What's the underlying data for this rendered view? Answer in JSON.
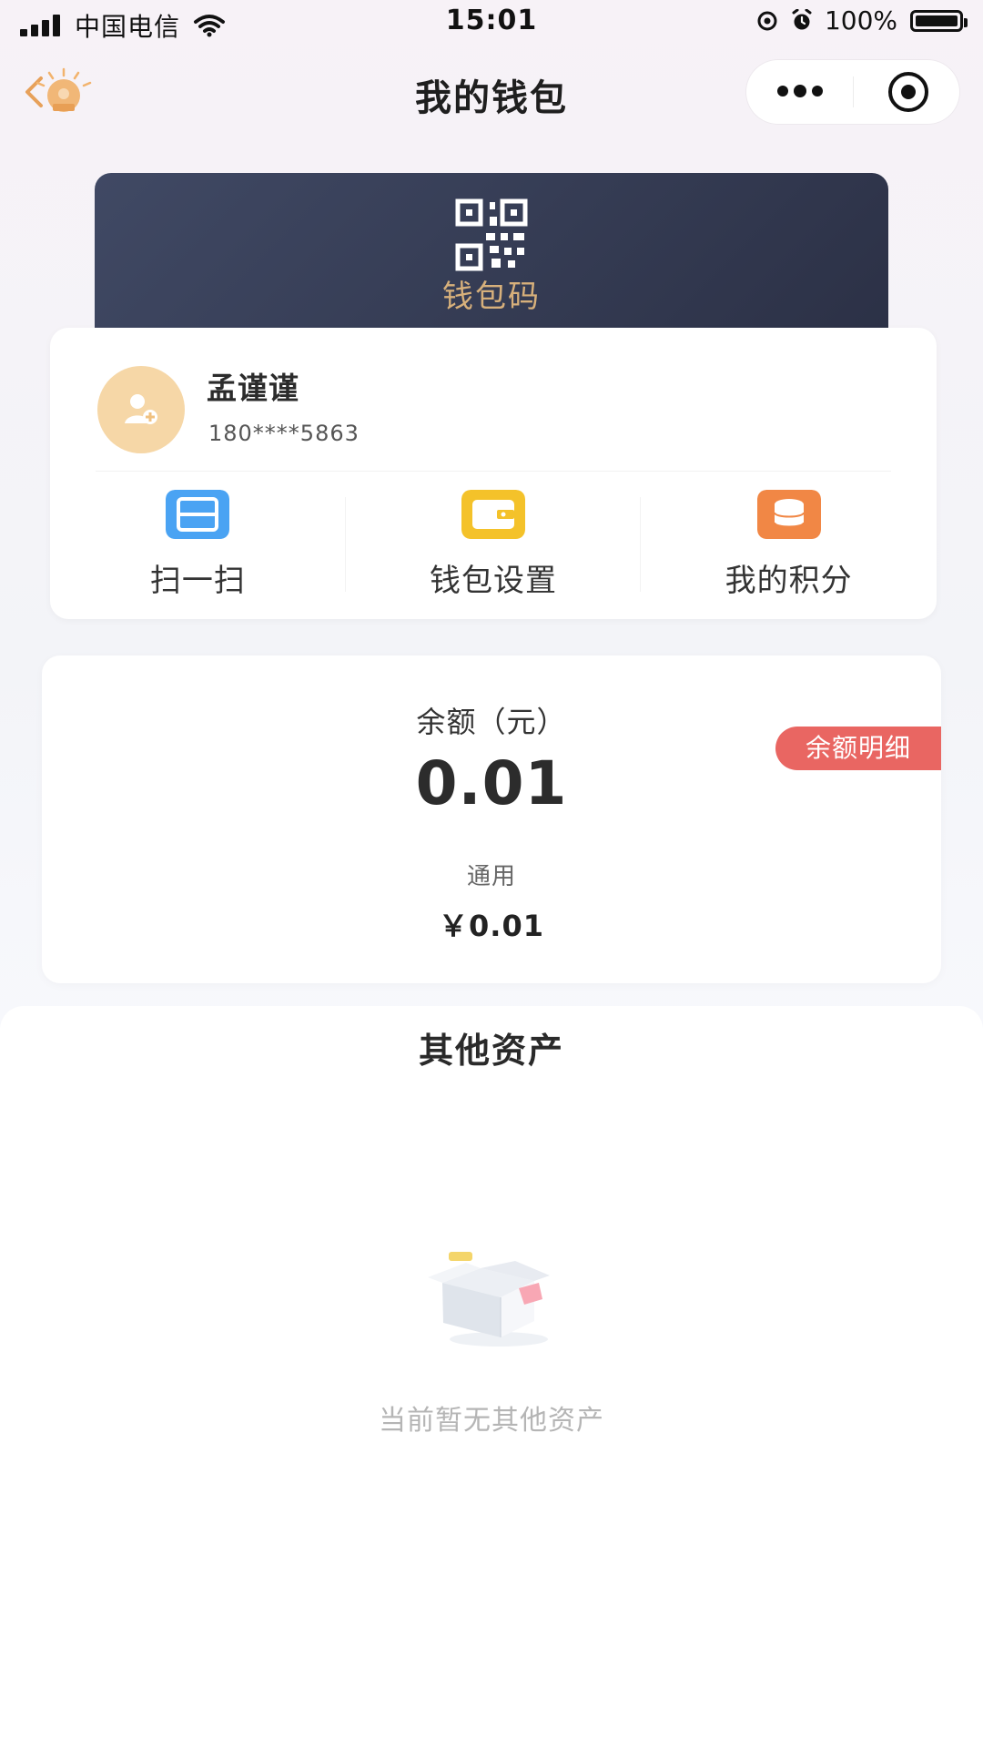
{
  "status_bar": {
    "carrier": "中国电信",
    "time": "15:01",
    "battery": "100%",
    "battery_level": 1.0
  },
  "header": {
    "title": "我的钱包"
  },
  "wallet_code": {
    "label": "钱包码"
  },
  "user": {
    "name": "孟谨谨",
    "phone": "180****5863"
  },
  "actions": [
    {
      "label": "扫一扫",
      "icon": "scan-icon",
      "color": "#46a2f1"
    },
    {
      "label": "钱包设置",
      "icon": "wallet-icon",
      "color": "#f3c22b"
    },
    {
      "label": "我的积分",
      "icon": "coins-icon",
      "color": "#f08843"
    }
  ],
  "balance": {
    "label": "余额（元）",
    "amount": "0.01",
    "detail_label": "余额明细",
    "general_label": "通用",
    "general_value": "￥0.01"
  },
  "other_assets": {
    "title": "其他资产",
    "empty_text": "当前暂无其他资产"
  },
  "colors": {
    "banner": "#343a53",
    "gold": "#d7b07b",
    "badge": "#e96662"
  }
}
